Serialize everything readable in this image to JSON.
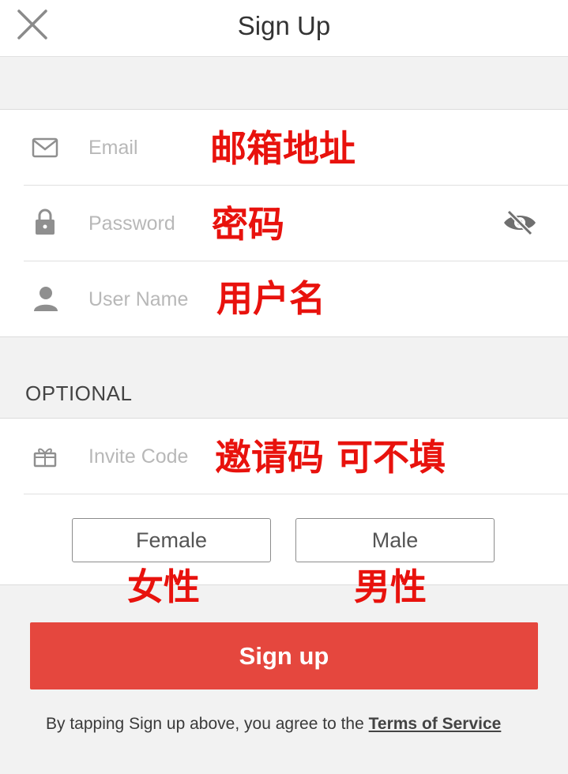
{
  "header": {
    "title": "Sign Up"
  },
  "fields": {
    "email": {
      "placeholder": "Email",
      "annotation": "邮箱地址"
    },
    "password": {
      "placeholder": "Password",
      "annotation": "密码"
    },
    "username": {
      "placeholder": "User Name",
      "annotation": "用户名"
    },
    "invite": {
      "placeholder": "Invite Code",
      "annotation": "邀请码 可不填"
    }
  },
  "optional_label": "OPTIONAL",
  "gender": {
    "female_label": "Female",
    "male_label": "Male",
    "female_annotation": "女性",
    "male_annotation": "男性"
  },
  "signup_label": "Sign up",
  "terms": {
    "prefix": "By tapping Sign up above, you agree to the ",
    "link": "Terms of Service"
  },
  "colors": {
    "accent": "#e5473e",
    "annotation": "#e8120d"
  },
  "icons": [
    "close-icon",
    "mail-icon",
    "lock-icon",
    "eye-off-icon",
    "user-icon",
    "gift-icon"
  ]
}
